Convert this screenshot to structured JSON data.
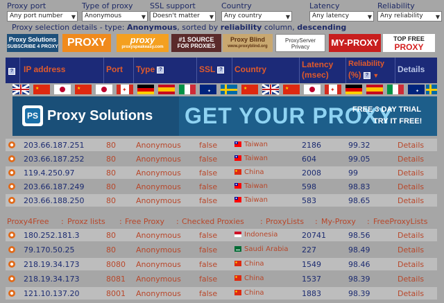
{
  "filters": [
    {
      "label": "Proxy port",
      "value": "Any port number"
    },
    {
      "label": "Type of proxy",
      "value": "Anonymous"
    },
    {
      "label": "SSL support",
      "value": "Doesn't matter"
    },
    {
      "label": "Country",
      "value": "Any country"
    },
    {
      "label": "Latency",
      "value": "Any latency"
    },
    {
      "label": "Reliability",
      "value": "Any reliability"
    }
  ],
  "selection": {
    "prefix": "Proxy selection details - type: ",
    "type": "Anonymous",
    "mid": ", sorted by ",
    "sortcol": "reliability",
    "mid2": " column, ",
    "order": "descending"
  },
  "banners": [
    {
      "name": "banner-proxy-solutions-small",
      "line1": "Proxy Solutions",
      "line2": "SUBSCRIBE 4 PROXY",
      "bg": "#1d4f7a",
      "fg": "#ffffff"
    },
    {
      "name": "banner-proxy-orange",
      "line1": "PROXY",
      "line2": "",
      "bg": "#f08a1c",
      "fg": "#ffffff"
    },
    {
      "name": "banner-proxy-italic",
      "line1": "proxy",
      "line2": "proxyspeakeasy.com",
      "bg": "#f4a020",
      "fg": "#ffffff"
    },
    {
      "name": "banner-1-source",
      "line1": "#1 SOURCE",
      "line2": "FOR PROXIES",
      "bg": "#5a2a2a",
      "fg": "#ffffff"
    },
    {
      "name": "banner-proxy-blind",
      "line1": "Proxy Blind",
      "line2": "www.proxyblind.org",
      "bg": "#c9a870",
      "fg": "#5a3010"
    },
    {
      "name": "banner-proxyserver-privacy",
      "line1": "ProxyServer",
      "line2": "Privacy",
      "bg": "#ffffff",
      "fg": "#333333"
    },
    {
      "name": "banner-my-proxy",
      "line1": "MY-PROXY",
      "line2": "",
      "bg": "#c81e1e",
      "fg": "#ffffff"
    },
    {
      "name": "banner-top-free-proxy",
      "line1": "TOP FREE",
      "line2": "PROXY",
      "bg": "#ffffff",
      "fg": "#d41e1e"
    }
  ],
  "columns": {
    "ip": "IP address",
    "port": "Port",
    "type": "Type",
    "ssl": "SSL",
    "country": "Country",
    "latency1": "Latency",
    "latency2": "(msec)",
    "rel1": "Reliability",
    "rel2": "(%)",
    "details": "Details"
  },
  "big_banner": {
    "brand": "Proxy Solutions",
    "headline": "GET YOUR PROXY",
    "promo1": "FREE 3 DAY TRIAL",
    "promo2": "TRY IT FREE!"
  },
  "rows": [
    {
      "ip": "203.66.187.251",
      "port": "80",
      "type": "Anonymous",
      "ssl": "false",
      "country": "Taiwan",
      "flag": "tw",
      "latency": "2186",
      "reliability": "99.32",
      "details": "Details"
    },
    {
      "ip": "203.66.187.252",
      "port": "80",
      "type": "Anonymous",
      "ssl": "false",
      "country": "Taiwan",
      "flag": "tw",
      "latency": "604",
      "reliability": "99.05",
      "details": "Details"
    },
    {
      "ip": "119.4.250.97",
      "port": "80",
      "type": "Anonymous",
      "ssl": "false",
      "country": "China",
      "flag": "cn",
      "latency": "2008",
      "reliability": "99",
      "details": "Details"
    },
    {
      "ip": "203.66.187.249",
      "port": "80",
      "type": "Anonymous",
      "ssl": "false",
      "country": "Taiwan",
      "flag": "tw",
      "latency": "598",
      "reliability": "98.83",
      "details": "Details"
    },
    {
      "ip": "203.66.188.250",
      "port": "80",
      "type": "Anonymous",
      "ssl": "false",
      "country": "Taiwan",
      "flag": "tw",
      "latency": "583",
      "reliability": "98.65",
      "details": "Details"
    },
    {
      "ip": "180.252.181.3",
      "port": "80",
      "type": "Anonymous",
      "ssl": "false",
      "country": "Indonesia",
      "flag": "id",
      "latency": "20741",
      "reliability": "98.56",
      "details": "Details"
    },
    {
      "ip": "79.170.50.25",
      "port": "80",
      "type": "Anonymous",
      "ssl": "false",
      "country": "Saudi Arabia",
      "flag": "sa",
      "latency": "227",
      "reliability": "98.49",
      "details": "Details"
    },
    {
      "ip": "218.19.34.173",
      "port": "8080",
      "type": "Anonymous",
      "ssl": "false",
      "country": "China",
      "flag": "cn",
      "latency": "1549",
      "reliability": "98.46",
      "details": "Details"
    },
    {
      "ip": "218.19.34.173",
      "port": "8081",
      "type": "Anonymous",
      "ssl": "false",
      "country": "China",
      "flag": "cn",
      "latency": "1537",
      "reliability": "98.39",
      "details": "Details"
    },
    {
      "ip": "121.10.137.20",
      "port": "8001",
      "type": "Anonymous",
      "ssl": "false",
      "country": "China",
      "flag": "cn",
      "latency": "1883",
      "reliability": "98.39",
      "details": "Details"
    }
  ],
  "links": [
    "Proxy4Free",
    "Proxz lists",
    "Free Proxy",
    "Checked Proxies",
    "ProxyLists",
    "My-Proxy",
    "FreeProxyLists"
  ],
  "link_separator": ":",
  "colors": {
    "header_bg": "#1c2a78",
    "header_text": "#e05a2b",
    "row_light": "#bdbdbd",
    "page_bg": "#a6a6a6"
  }
}
